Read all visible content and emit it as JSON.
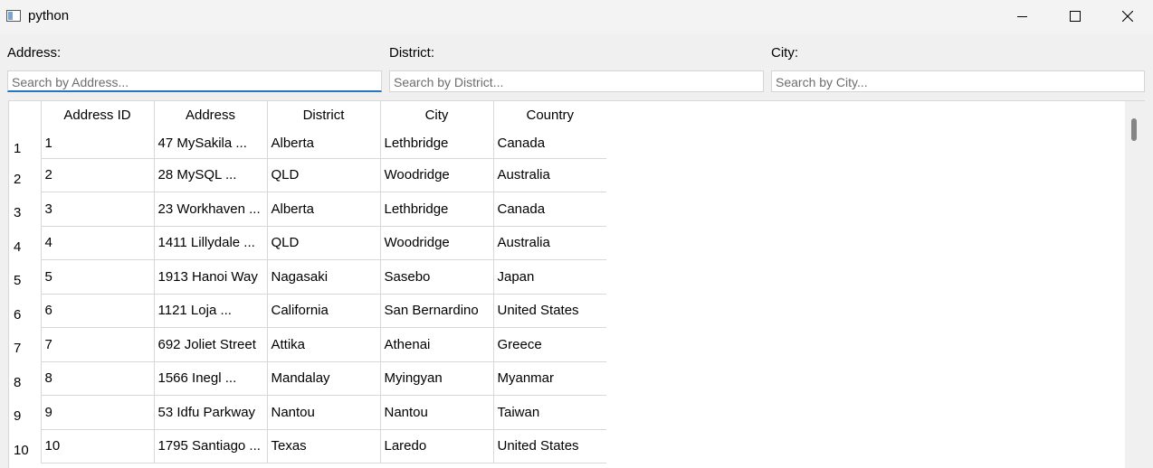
{
  "window": {
    "title": "python"
  },
  "filters": [
    {
      "label": "Address:",
      "placeholder": "Search by Address..."
    },
    {
      "label": "District:",
      "placeholder": "Search by District..."
    },
    {
      "label": "City:",
      "placeholder": "Search by City..."
    }
  ],
  "table": {
    "columns": [
      "Address ID",
      "Address",
      "District",
      "City",
      "Country"
    ],
    "rows": [
      {
        "n": "1",
        "cells": [
          "1",
          "47 MySakila ...",
          "Alberta",
          "Lethbridge",
          "Canada"
        ]
      },
      {
        "n": "2",
        "cells": [
          "2",
          "28 MySQL ...",
          "QLD",
          "Woodridge",
          "Australia"
        ]
      },
      {
        "n": "3",
        "cells": [
          "3",
          "23 Workhaven ...",
          "Alberta",
          "Lethbridge",
          "Canada"
        ]
      },
      {
        "n": "4",
        "cells": [
          "4",
          "1411 Lillydale ...",
          "QLD",
          "Woodridge",
          "Australia"
        ]
      },
      {
        "n": "5",
        "cells": [
          "5",
          "1913 Hanoi Way",
          "Nagasaki",
          "Sasebo",
          "Japan"
        ]
      },
      {
        "n": "6",
        "cells": [
          "6",
          "1121 Loja ...",
          "California",
          "San Bernardino",
          "United States"
        ]
      },
      {
        "n": "7",
        "cells": [
          "7",
          "692 Joliet Street",
          "Attika",
          "Athenai",
          "Greece"
        ]
      },
      {
        "n": "8",
        "cells": [
          "8",
          "1566 Inegl ...",
          "Mandalay",
          "Myingyan",
          "Myanmar"
        ]
      },
      {
        "n": "9",
        "cells": [
          "9",
          "53 Idfu Parkway",
          "Nantou",
          "Nantou",
          "Taiwan"
        ]
      },
      {
        "n": "10",
        "cells": [
          "10",
          "1795 Santiago ...",
          "Texas",
          "Laredo",
          "United States"
        ]
      }
    ]
  },
  "icons": {
    "app": "app-window-icon",
    "minimize": "minimize-icon",
    "maximize": "maximize-icon",
    "close": "close-icon"
  },
  "colors": {
    "focus_accent": "#2b74c0",
    "scroll_thumb": "#858585"
  }
}
